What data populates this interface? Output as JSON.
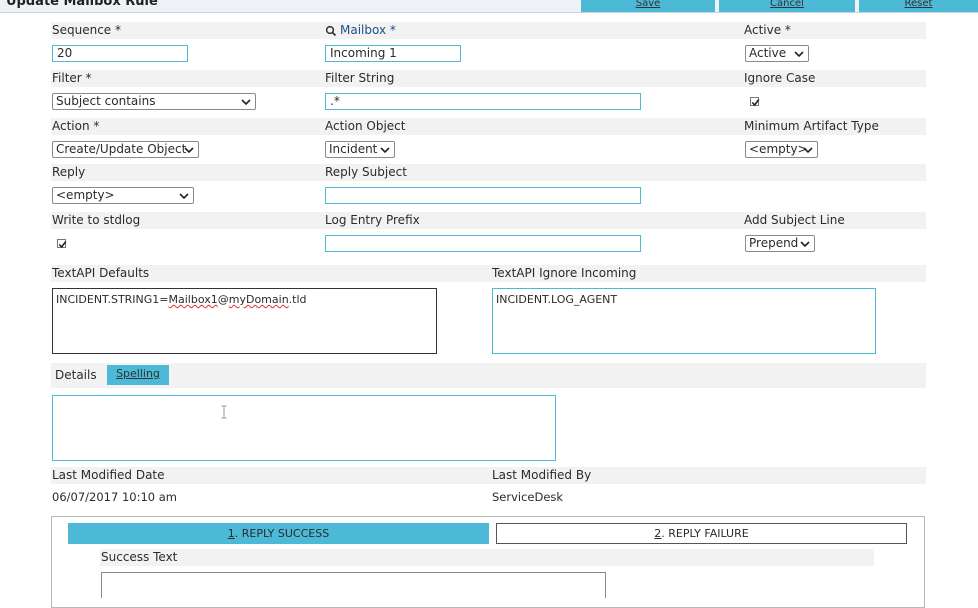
{
  "header": {
    "title": "Update Mailbox Rule",
    "save_label": "Save",
    "cancel_label": "Cancel",
    "reset_label": "Reset"
  },
  "fields": {
    "sequence": {
      "label": "Sequence *",
      "value": "20"
    },
    "mailbox": {
      "label": "Mailbox *",
      "value": "Incoming 1"
    },
    "active": {
      "label": "Active *",
      "value": "Active"
    },
    "filter": {
      "label": "Filter *",
      "value": "Subject contains"
    },
    "filter_string": {
      "label": "Filter String",
      "value": ".*"
    },
    "ignore_case": {
      "label": "Ignore Case",
      "checked": true
    },
    "action": {
      "label": "Action *",
      "value": "Create/Update Object"
    },
    "action_object": {
      "label": "Action Object",
      "value": "Incident"
    },
    "minimum_artifact_type": {
      "label": "Minimum Artifact Type",
      "value": "<empty>"
    },
    "reply": {
      "label": "Reply",
      "value": "<empty>"
    },
    "reply_subject": {
      "label": "Reply Subject",
      "value": ""
    },
    "write_to_stdlog": {
      "label": "Write to stdlog",
      "checked": true
    },
    "log_entry_prefix": {
      "label": "Log Entry Prefix",
      "value": ""
    },
    "add_subject_line": {
      "label": "Add Subject Line",
      "value": "Prepend"
    },
    "textapi_defaults": {
      "label": "TextAPI Defaults",
      "value_prefix": "INCIDENT.STRING1=",
      "value_misspelled_1": "Mailbox1",
      "value_at": "@",
      "value_misspelled_2": "myDomain",
      "value_suffix": ".tld"
    },
    "textapi_ignore_incoming": {
      "label": "TextAPI Ignore Incoming",
      "value": "INCIDENT.LOG_AGENT"
    },
    "details": {
      "label": "Details",
      "spelling_label": "Spelling",
      "value": ""
    },
    "last_modified_date": {
      "label": "Last Modified Date",
      "value": "06/07/2017 10:10 am"
    },
    "last_modified_by": {
      "label": "Last Modified By",
      "value": "ServiceDesk"
    }
  },
  "tabs": [
    {
      "number": "1",
      "label": ". REPLY SUCCESS",
      "active": true
    },
    {
      "number": "2",
      "label": ". REPLY FAILURE",
      "active": false
    }
  ],
  "success_text": {
    "label": "Success Text",
    "value": ""
  },
  "colors": {
    "accent": "#4cb9d6",
    "band": "#f2f2f2",
    "spell_error": "#e03030"
  }
}
